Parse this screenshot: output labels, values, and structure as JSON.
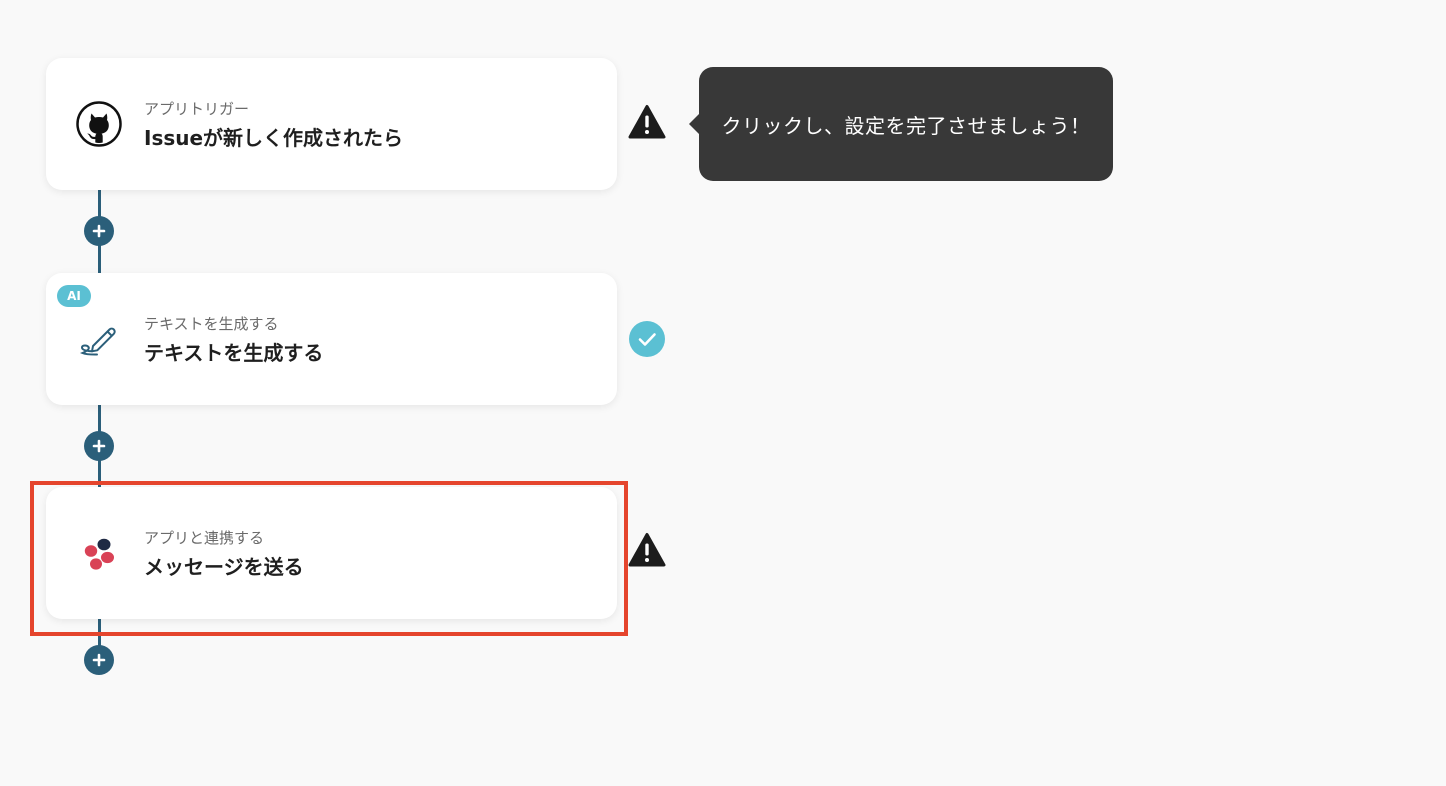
{
  "flow": {
    "steps": [
      {
        "subtitle": "アプリトリガー",
        "title": "Issueが新しく作成されたら",
        "icon": "github-icon",
        "status": "warning"
      },
      {
        "badge": "AI",
        "subtitle": "テキストを生成する",
        "title": "テキストを生成する",
        "icon": "pen-icon",
        "status": "completed"
      },
      {
        "subtitle": "アプリと連携する",
        "title": "メッセージを送る",
        "icon": "chatwork-icon",
        "status": "warning",
        "highlighted": true
      }
    ]
  },
  "tooltip": {
    "text": "クリックし、設定を完了させましょう！"
  },
  "colors": {
    "connector": "#2b5f7a",
    "ai_badge": "#5bc0d3",
    "check": "#5bc0d3",
    "highlight": "#e5452d",
    "tooltip_bg": "#383838"
  }
}
